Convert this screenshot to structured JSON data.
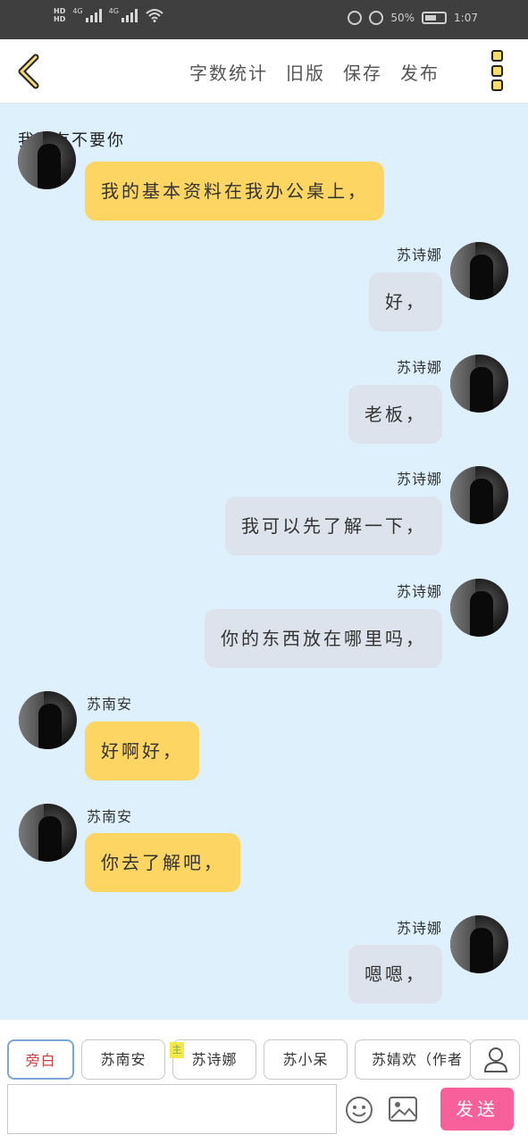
{
  "status_bar": {
    "hd1": "HD",
    "hd2": "HD",
    "net1": "4G",
    "net2": "4G",
    "battery_pct": "50%",
    "time": "1:07"
  },
  "top_bar": {
    "links": [
      "字数统计",
      "旧版",
      "保存",
      "发布"
    ]
  },
  "chat": {
    "narration": "我没有不要你",
    "messages": [
      {
        "side": "left",
        "sender": "",
        "text": "我的基本资料在我办公桌上，",
        "color": "#fdd562"
      },
      {
        "side": "right",
        "sender": "苏诗娜",
        "text": "好，",
        "color": "#dde3ec"
      },
      {
        "side": "right",
        "sender": "苏诗娜",
        "text": "老板，",
        "color": "#dde3ec"
      },
      {
        "side": "right",
        "sender": "苏诗娜",
        "text": "我可以先了解一下，",
        "color": "#dde3ec"
      },
      {
        "side": "right",
        "sender": "苏诗娜",
        "text": "你的东西放在哪里吗，",
        "color": "#dde3ec"
      },
      {
        "side": "left",
        "sender": "苏南安",
        "text": "好啊好，",
        "color": "#fdd562"
      },
      {
        "side": "left",
        "sender": "苏南安",
        "text": "你去了解吧，",
        "color": "#fdd562"
      },
      {
        "side": "right",
        "sender": "苏诗娜",
        "text": "嗯嗯，",
        "color": "#dde3ec"
      }
    ]
  },
  "bottom": {
    "roles": [
      "旁白",
      "苏南安",
      "苏诗娜",
      "苏小呆",
      "苏婧欢（作者"
    ],
    "main_tag": "主",
    "input_value": "",
    "input_placeholder": "",
    "send_label": "发送"
  },
  "colors": {
    "background": "#ddf0fb",
    "left_bubble": "#fdd562",
    "right_bubble": "#dde3ec",
    "send_button": "#f7609a",
    "menu_accent": "#f6dd6b"
  }
}
